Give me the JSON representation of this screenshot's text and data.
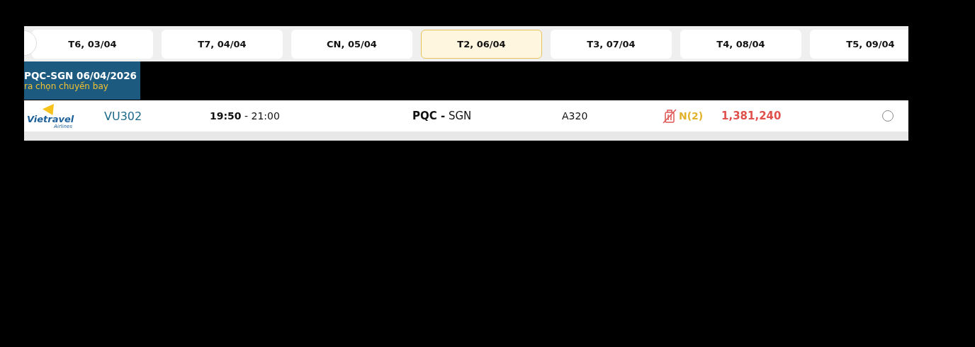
{
  "date_tabs": [
    {
      "label": "T6, 03/04",
      "selected": false
    },
    {
      "label": "T7, 04/04",
      "selected": false
    },
    {
      "label": "CN, 05/04",
      "selected": false
    },
    {
      "label": "T2, 06/04",
      "selected": true
    },
    {
      "label": "T3, 07/04",
      "selected": false
    },
    {
      "label": "T4, 08/04",
      "selected": false
    },
    {
      "label": "T5, 09/04",
      "selected": false
    }
  ],
  "header": {
    "title": "PQC-SGN 06/04/2026",
    "subtitle": "ra chọn chuyến bay"
  },
  "flights": [
    {
      "airline_logo": {
        "name": "Vietravel",
        "tagline": "Airlines"
      },
      "flight_number": "VU302",
      "departure": "19:50",
      "separator": "-",
      "arrival": "21:00",
      "origin": "PQC -",
      "destination": "SGN",
      "aircraft": "A320",
      "baggage_included": false,
      "fare_class": "N(2)",
      "price": "1,381,240",
      "selected": false
    }
  ]
}
